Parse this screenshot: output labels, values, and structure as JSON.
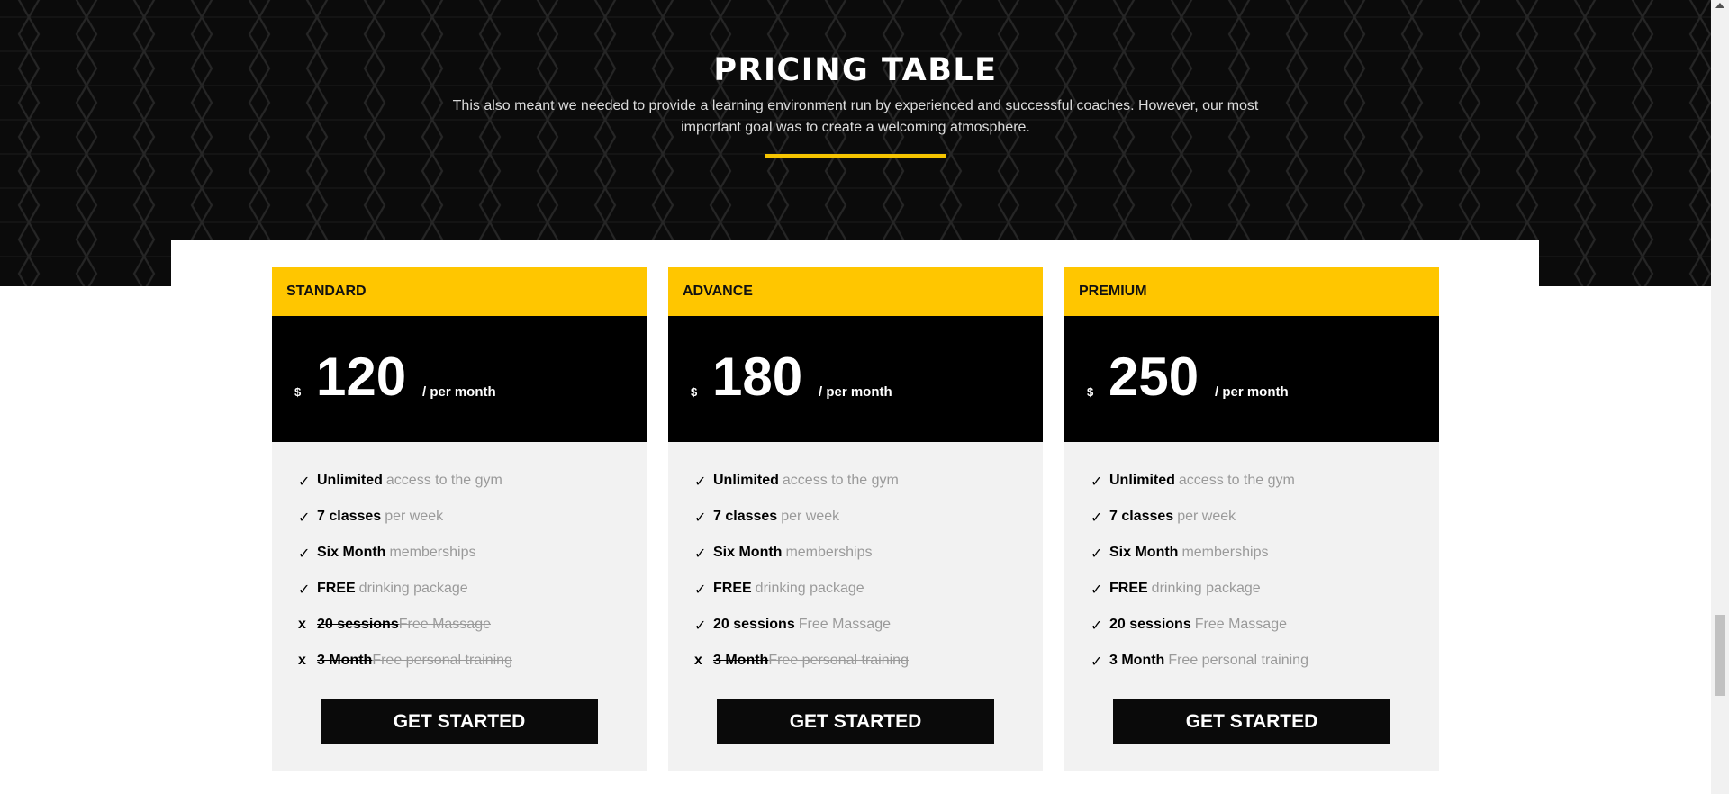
{
  "hero": {
    "title": "PRICING TABLE",
    "description": "This also meant we needed to provide a learning environment run by experienced and successful coaches. However, our most important goal was to create a welcoming atmosphere."
  },
  "accent_color": "#ffc600",
  "plans": [
    {
      "name": "STANDARD",
      "currency": "$",
      "price": "120",
      "period": "/ per month",
      "features": [
        {
          "mark": "✓",
          "strong": "Unlimited",
          "text": "access to the gym",
          "included": true
        },
        {
          "mark": "✓",
          "strong": "7 classes",
          "text": "per week",
          "included": true
        },
        {
          "mark": "✓",
          "strong": "Six Month",
          "text": "memberships",
          "included": true
        },
        {
          "mark": "✓",
          "strong": "FREE",
          "text": "drinking package",
          "included": true
        },
        {
          "mark": "x",
          "strong": "20 sessions ",
          "text": "Free Massage",
          "included": false
        },
        {
          "mark": "x",
          "strong": "3 Month ",
          "text": "Free personal training",
          "included": false
        }
      ],
      "button": "GET STARTED"
    },
    {
      "name": "ADVANCE",
      "currency": "$",
      "price": "180",
      "period": "/ per month",
      "features": [
        {
          "mark": "✓",
          "strong": "Unlimited",
          "text": "access to the gym",
          "included": true
        },
        {
          "mark": "✓",
          "strong": "7 classes",
          "text": "per week",
          "included": true
        },
        {
          "mark": "✓",
          "strong": "Six Month",
          "text": "memberships",
          "included": true
        },
        {
          "mark": "✓",
          "strong": "FREE",
          "text": "drinking package",
          "included": true
        },
        {
          "mark": "✓",
          "strong": "20 sessions",
          "text": "Free Massage",
          "included": true
        },
        {
          "mark": "x",
          "strong": "3 Month ",
          "text": "Free personal training",
          "included": false
        }
      ],
      "button": "GET STARTED"
    },
    {
      "name": "PREMIUM",
      "currency": "$",
      "price": "250",
      "period": "/ per month",
      "features": [
        {
          "mark": "✓",
          "strong": "Unlimited",
          "text": "access to the gym",
          "included": true
        },
        {
          "mark": "✓",
          "strong": "7 classes",
          "text": "per week",
          "included": true
        },
        {
          "mark": "✓",
          "strong": "Six Month",
          "text": "memberships",
          "included": true
        },
        {
          "mark": "✓",
          "strong": "FREE",
          "text": "drinking package",
          "included": true
        },
        {
          "mark": "✓",
          "strong": "20 sessions",
          "text": "Free Massage",
          "included": true
        },
        {
          "mark": "✓",
          "strong": "3 Month",
          "text": "Free personal training",
          "included": true
        }
      ],
      "button": "GET STARTED"
    }
  ]
}
